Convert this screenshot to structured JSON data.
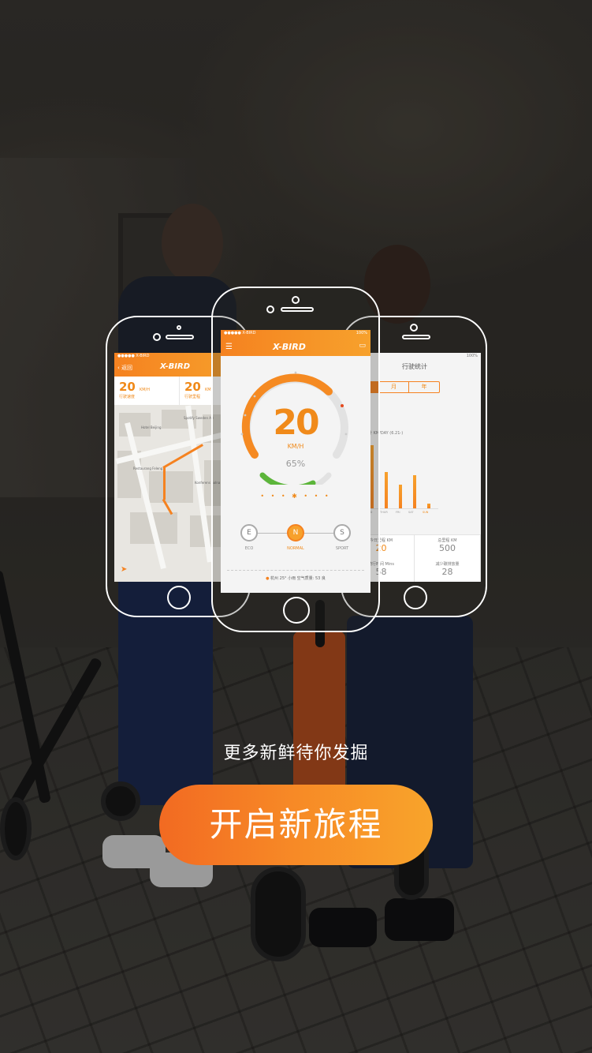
{
  "center_phone": {
    "status_left": "●●●●● X-BIRD",
    "status_right": "100%",
    "logo": "X-BIRD",
    "speed": "20",
    "speed_unit": "KM/H",
    "battery_percent": "65%",
    "bt_indicator": "• • • ✱ • • •",
    "modes": [
      {
        "letter": "E",
        "name": "ECO"
      },
      {
        "letter": "N",
        "name": "NORMAL"
      },
      {
        "letter": "S",
        "name": "SPORT"
      }
    ],
    "footer": "杭州 25° 小雨 空气质量: 53 良"
  },
  "left_phone": {
    "status_left": "●●●●● X-BIRD",
    "back_label": "‹ 返回",
    "logo": "X-BIRD",
    "stat1_value": "20",
    "stat1_unit": "KM/H",
    "stat1_label": "行驶速度",
    "stat2_value": "20",
    "stat2_unit": "KM",
    "stat2_label": "行驶里程",
    "poi1": "Hotel Beijing",
    "poi2": "Spotify Sweden AB",
    "poi3": "Restaurang Feleng",
    "poi4": "Konferens Solna"
  },
  "right_phone": {
    "status_right": "100%",
    "title": "行驶统计",
    "tabs": [
      "周",
      "月",
      "年"
    ],
    "chart_title": "一周驾驶统计 KM/DAY (6.21-)",
    "weekdays": [
      "TUE",
      "WED",
      "THUR",
      "FRI",
      "SAT",
      "SUN"
    ],
    "cells": [
      {
        "key": "今日里程 KM",
        "value": "20"
      },
      {
        "key": "总里程 KM",
        "value": "500"
      },
      {
        "key": "骑行时间 Mins",
        "value": "58"
      },
      {
        "key": "减少碳排放量",
        "value": "28"
      }
    ]
  },
  "tagline": "更多新鲜待你发掘",
  "cta_label": "开启新旅程",
  "colors": {
    "accent": "#f58220",
    "accent_light": "#f8a42b"
  }
}
